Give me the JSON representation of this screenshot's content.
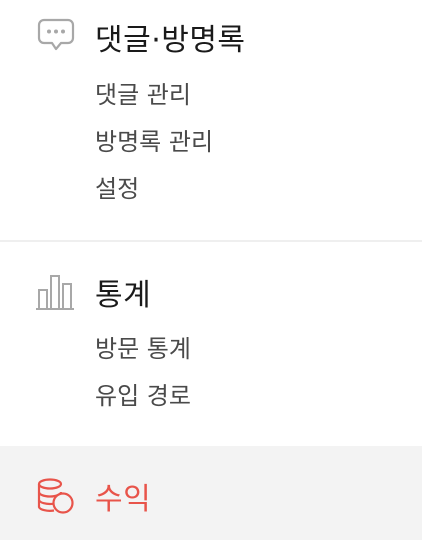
{
  "comments": {
    "title": "댓글·방명록",
    "items": [
      {
        "label": "댓글 관리"
      },
      {
        "label": "방명록 관리"
      },
      {
        "label": "설정"
      }
    ]
  },
  "stats": {
    "title": "통계",
    "items": [
      {
        "label": "방문 통계"
      },
      {
        "label": "유입 경로"
      }
    ]
  },
  "revenue": {
    "title": "수익",
    "active": true
  },
  "colors": {
    "accent": "#e8544a",
    "icon_gray": "#a8a8a8",
    "text_dark": "#1a1a1a",
    "text_sub": "#4a4a4a",
    "active_bg": "#f3f3f3"
  },
  "icons": {
    "comments": "speech-bubble-icon",
    "stats": "bar-chart-icon",
    "revenue": "coins-icon"
  }
}
